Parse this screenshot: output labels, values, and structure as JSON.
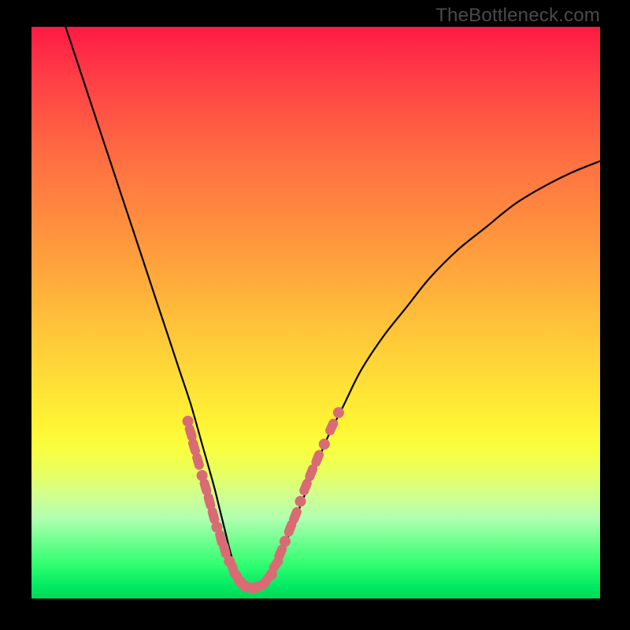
{
  "watermark": "TheBottleneck.com",
  "colors": {
    "background": "#000000",
    "curve": "#000000",
    "marker": "#d96b75",
    "gradient_top": "#ff1a45",
    "gradient_bottom": "#00d858"
  },
  "chart_data": {
    "type": "line",
    "title": "",
    "xlabel": "",
    "ylabel": "",
    "xlim": [
      0,
      100
    ],
    "ylim": [
      0,
      100
    ],
    "series": [
      {
        "name": "bottleneck-curve",
        "x": [
          6,
          8,
          10,
          12,
          14,
          16,
          18,
          20,
          22,
          24,
          26,
          28,
          30,
          32,
          33,
          34,
          35,
          36,
          37,
          38,
          39,
          40,
          42,
          44,
          46,
          48,
          50,
          52,
          55,
          58,
          62,
          66,
          70,
          75,
          80,
          85,
          90,
          95,
          100
        ],
        "y": [
          100,
          94,
          88,
          82,
          76,
          70,
          64,
          58,
          52,
          46,
          40,
          34,
          27,
          20,
          16,
          12,
          8,
          5,
          3,
          2,
          2,
          2.5,
          4,
          8,
          13,
          18,
          23,
          28,
          34,
          40,
          46,
          51,
          56,
          61,
          65,
          69,
          72,
          74.5,
          76.5
        ]
      }
    ],
    "markers": [
      {
        "x": 27.5,
        "y": 31,
        "shape": "circle"
      },
      {
        "x": 28.0,
        "y": 29,
        "shape": "pill"
      },
      {
        "x": 28.6,
        "y": 26.5,
        "shape": "pill"
      },
      {
        "x": 29.3,
        "y": 24,
        "shape": "pill"
      },
      {
        "x": 30.0,
        "y": 21.5,
        "shape": "circle"
      },
      {
        "x": 30.6,
        "y": 19.5,
        "shape": "pill"
      },
      {
        "x": 31.3,
        "y": 17,
        "shape": "pill"
      },
      {
        "x": 32.0,
        "y": 14.5,
        "shape": "pill"
      },
      {
        "x": 32.6,
        "y": 12.5,
        "shape": "circle"
      },
      {
        "x": 33.3,
        "y": 10.5,
        "shape": "pill"
      },
      {
        "x": 34.0,
        "y": 8.5,
        "shape": "pill"
      },
      {
        "x": 34.8,
        "y": 6.5,
        "shape": "circle"
      },
      {
        "x": 35.5,
        "y": 5,
        "shape": "pill"
      },
      {
        "x": 36.3,
        "y": 3.5,
        "shape": "pill"
      },
      {
        "x": 37.2,
        "y": 2.5,
        "shape": "pill"
      },
      {
        "x": 38.2,
        "y": 2,
        "shape": "pill"
      },
      {
        "x": 39.2,
        "y": 2,
        "shape": "pill"
      },
      {
        "x": 40.2,
        "y": 2.2,
        "shape": "pill"
      },
      {
        "x": 41.2,
        "y": 3,
        "shape": "pill"
      },
      {
        "x": 42.2,
        "y": 4.2,
        "shape": "circle"
      },
      {
        "x": 43.0,
        "y": 6,
        "shape": "pill"
      },
      {
        "x": 43.8,
        "y": 8,
        "shape": "pill"
      },
      {
        "x": 44.6,
        "y": 10,
        "shape": "circle"
      },
      {
        "x": 45.5,
        "y": 12.3,
        "shape": "pill"
      },
      {
        "x": 46.4,
        "y": 14.5,
        "shape": "pill"
      },
      {
        "x": 47.3,
        "y": 17,
        "shape": "circle"
      },
      {
        "x": 48.2,
        "y": 19.5,
        "shape": "pill"
      },
      {
        "x": 49.2,
        "y": 22,
        "shape": "pill"
      },
      {
        "x": 50.3,
        "y": 24.5,
        "shape": "pill"
      },
      {
        "x": 51.5,
        "y": 27,
        "shape": "circle"
      },
      {
        "x": 52.8,
        "y": 30,
        "shape": "pill"
      },
      {
        "x": 54.0,
        "y": 32.5,
        "shape": "circle"
      }
    ]
  }
}
